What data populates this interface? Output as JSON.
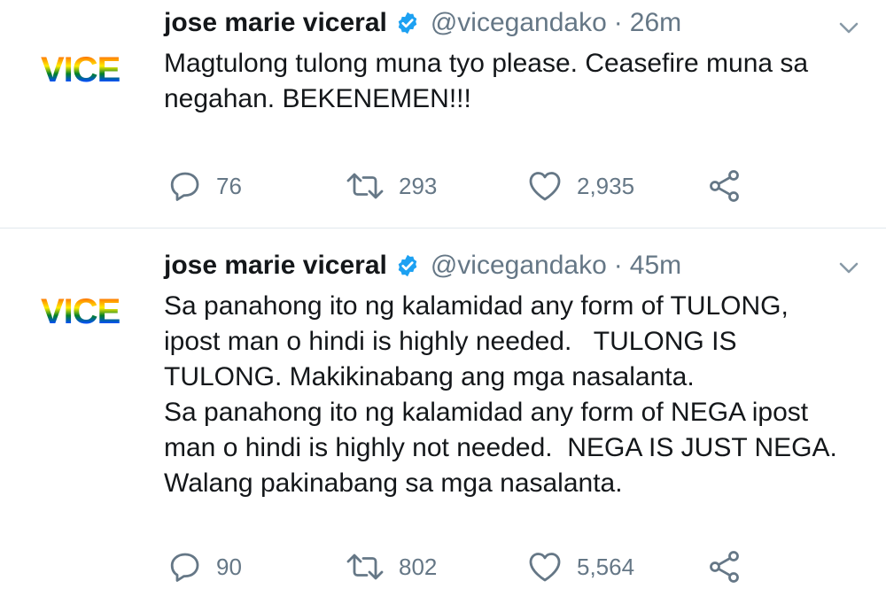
{
  "tweets": [
    {
      "avatar_text": "VICE",
      "name": "jose marie viceral",
      "handle": "@vicegandako",
      "separator": "·",
      "time": "26m",
      "text": "Magtulong tulong muna tyo please. Ceasefire muna sa\nnegahan. BEKENEMEN!!!",
      "replies": "76",
      "retweets": "293",
      "likes": "2,935"
    },
    {
      "avatar_text": "VICE",
      "name": "jose marie viceral",
      "handle": "@vicegandako",
      "separator": "·",
      "time": "45m",
      "text": "Sa panahong ito ng kalamidad any form of TULONG,\nipost man o hindi is highly needed.   TULONG IS\nTULONG. Makikinabang ang mga nasalanta.\nSa panahong ito ng kalamidad any form of NEGA ipost\nman o hindi is highly not needed.  NEGA IS JUST NEGA.\nWalang pakinabang sa mga nasalanta.",
      "replies": "90",
      "retweets": "802",
      "likes": "5,564"
    }
  ],
  "icons": {
    "verified": "verified-badge-icon",
    "caret": "chevron-down-icon",
    "reply": "reply-icon",
    "retweet": "retweet-icon",
    "like": "heart-icon",
    "share": "share-icon"
  },
  "colors": {
    "text": "#14171a",
    "muted": "#657786",
    "verified": "#1da1f2",
    "divider": "#e1e8ed"
  }
}
